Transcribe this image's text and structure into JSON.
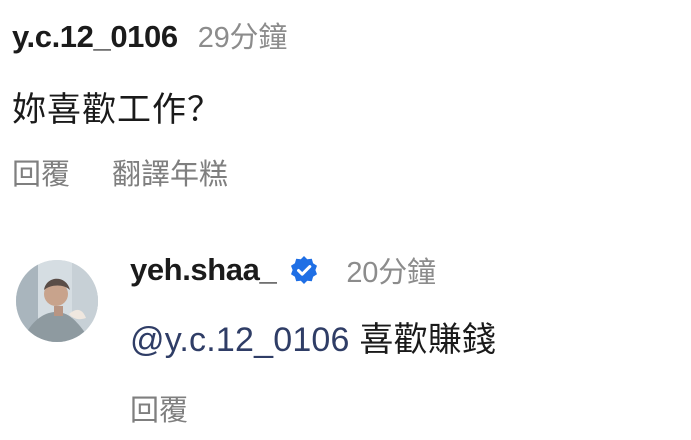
{
  "comment": {
    "username": "y.c.12_0106",
    "time": "29分鐘",
    "text": "妳喜歡工作？",
    "actions": {
      "reply_label": "回覆",
      "translate_label": "翻譯年糕"
    }
  },
  "reply": {
    "avatar_icon": "avatar-photo",
    "username": "yeh.shaa_",
    "verified_icon": "verified-badge-icon",
    "verified_color": "#1f6fe5",
    "time": "20分鐘",
    "mention": "@y.c.12_0106",
    "text": "喜歡賺錢",
    "actions": {
      "reply_label": "回覆"
    }
  }
}
